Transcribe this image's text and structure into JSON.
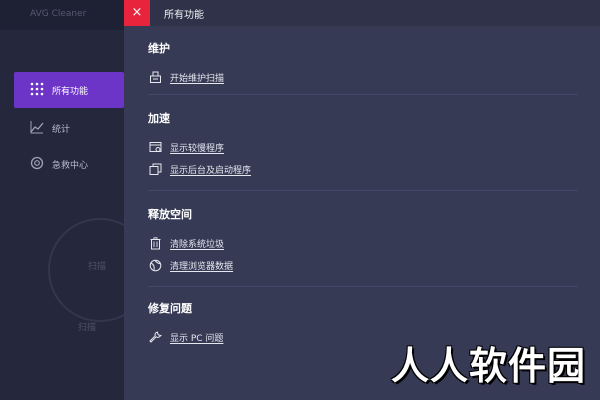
{
  "background_app": {
    "title": "AVG Cleaner",
    "sidebar": [
      {
        "label": "所有功能",
        "icon": "grid-icon",
        "active": true
      },
      {
        "label": "统计",
        "icon": "chart-icon",
        "active": false
      },
      {
        "label": "急救中心",
        "icon": "lifebuoy-icon",
        "active": false
      }
    ],
    "circle_label": "扫描",
    "scan_label": "扫描"
  },
  "panel": {
    "close_label": "×",
    "title": "所有功能",
    "sections": [
      {
        "title": "维护",
        "items": [
          {
            "label": "开始维护扫描",
            "icon": "maintenance-icon"
          }
        ]
      },
      {
        "title": "加速",
        "items": [
          {
            "label": "显示较慢程序",
            "icon": "slow-program-icon"
          },
          {
            "label": "显示后台及启动程序",
            "icon": "background-app-icon"
          }
        ]
      },
      {
        "title": "释放空间",
        "items": [
          {
            "label": "清除系统垃圾",
            "icon": "trash-icon"
          },
          {
            "label": "清理浏览器数据",
            "icon": "browser-icon"
          }
        ]
      },
      {
        "title": "修复问题",
        "items": [
          {
            "label": "显示 PC 问题",
            "icon": "wrench-icon"
          }
        ]
      }
    ]
  },
  "watermark": "人人软件园",
  "colors": {
    "accent": "#6c35c7",
    "close": "#e8243c",
    "panel": "#363a55"
  }
}
